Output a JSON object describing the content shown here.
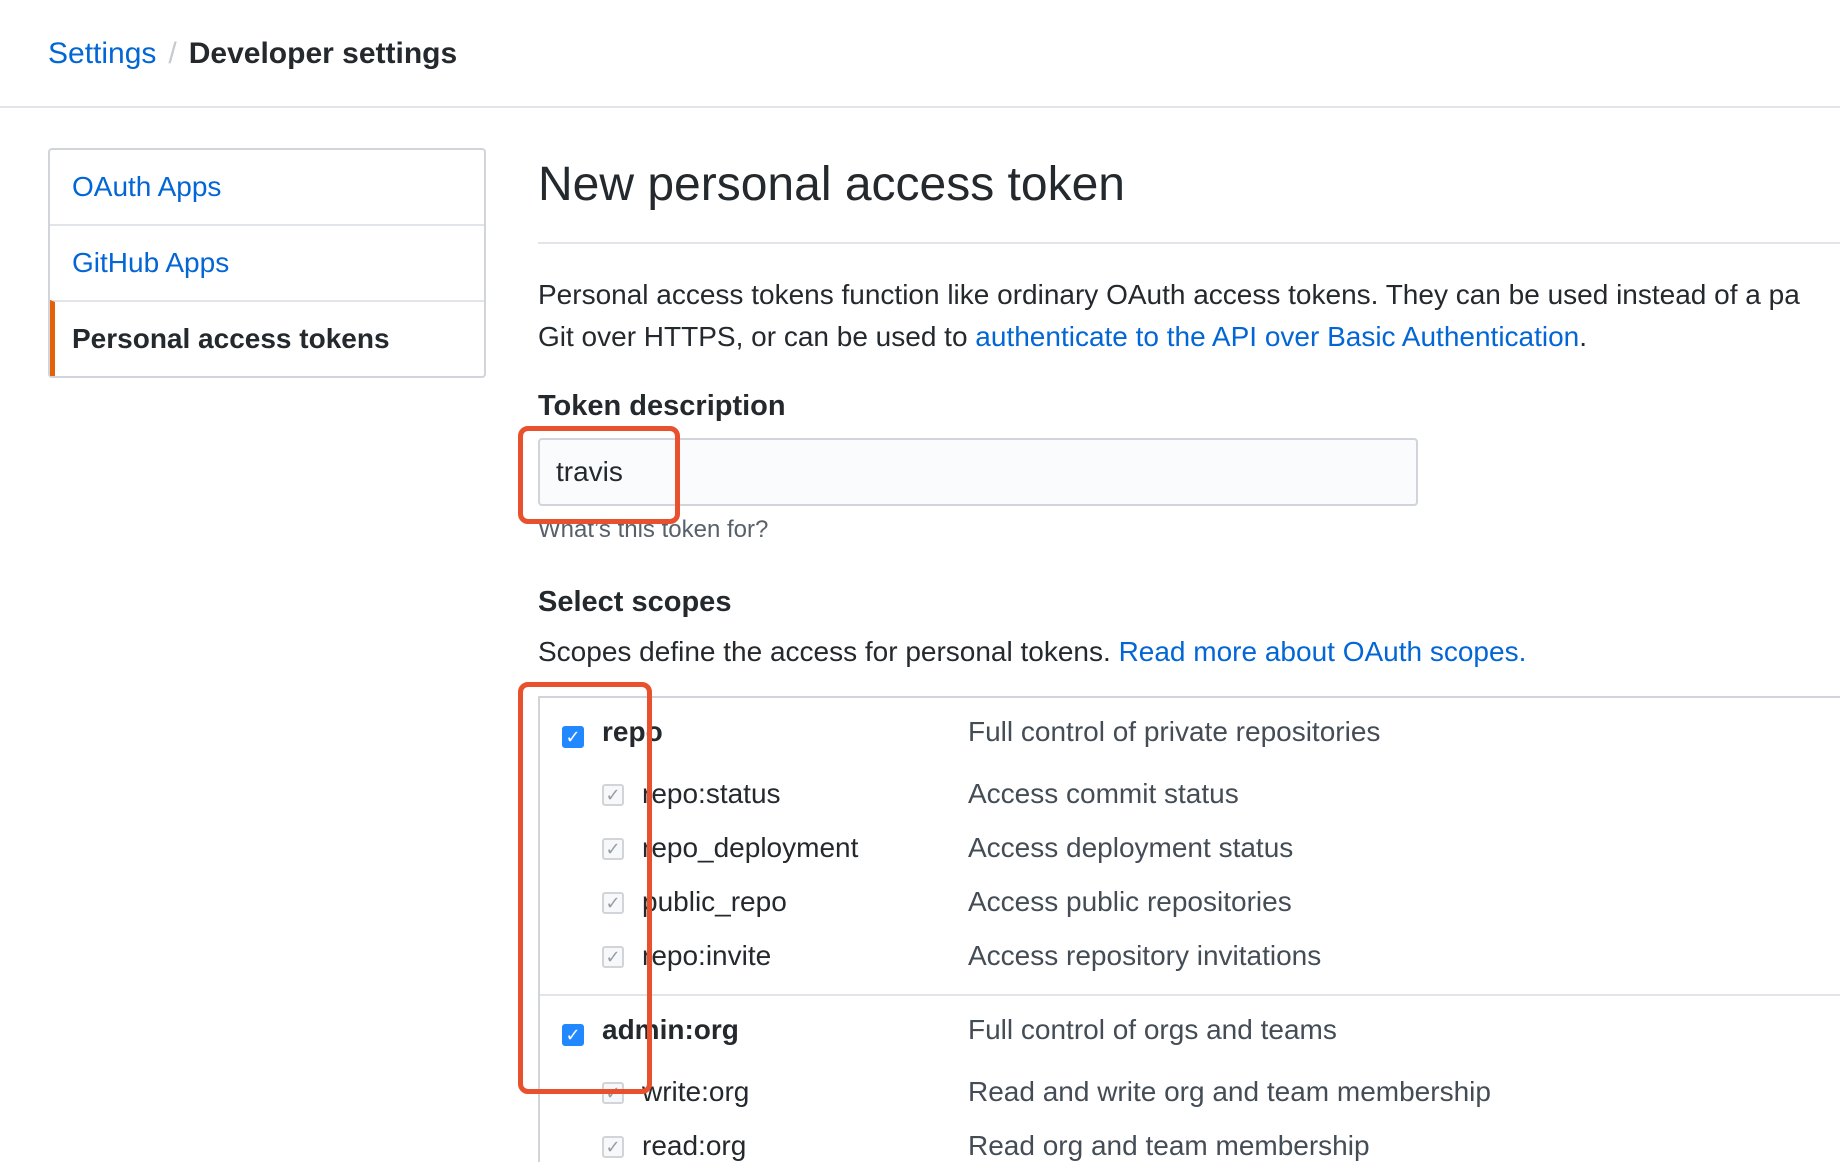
{
  "breadcrumb": {
    "parent": "Settings",
    "separator": "/",
    "current": "Developer settings"
  },
  "sidebar": {
    "items": [
      {
        "label": "OAuth Apps",
        "active": false
      },
      {
        "label": "GitHub Apps",
        "active": false
      },
      {
        "label": "Personal access tokens",
        "active": true
      }
    ]
  },
  "page": {
    "title": "New personal access token",
    "intro_line1": "Personal access tokens function like ordinary OAuth access tokens. They can be used instead of a pa",
    "intro_line2_prefix": "Git over HTTPS, or can be used to ",
    "intro_link": "authenticate to the API over Basic Authentication",
    "intro_line2_suffix": "."
  },
  "token": {
    "label": "Token description",
    "value": "travis",
    "note": "What’s this token for?"
  },
  "scopes": {
    "heading": "Select scopes",
    "description": "Scopes define the access for personal tokens. ",
    "link": "Read more about OAuth scopes.",
    "groups": [
      {
        "name": "repo",
        "desc": "Full control of private repositories",
        "checked": true,
        "children": [
          {
            "name": "repo:status",
            "desc": "Access commit status"
          },
          {
            "name": "repo_deployment",
            "desc": "Access deployment status"
          },
          {
            "name": "public_repo",
            "desc": "Access public repositories"
          },
          {
            "name": "repo:invite",
            "desc": "Access repository invitations"
          }
        ]
      },
      {
        "name": "admin:org",
        "desc": "Full control of orgs and teams",
        "checked": true,
        "children": [
          {
            "name": "write:org",
            "desc": "Read and write org and team membership"
          },
          {
            "name": "read:org",
            "desc": "Read org and team membership"
          }
        ]
      }
    ]
  },
  "colors": {
    "link": "#0366d6",
    "accent": "#e36209",
    "checkbox": "#2188ff",
    "annotation": "#e8502e"
  },
  "icons": {
    "checked": "checkmark-icon"
  }
}
